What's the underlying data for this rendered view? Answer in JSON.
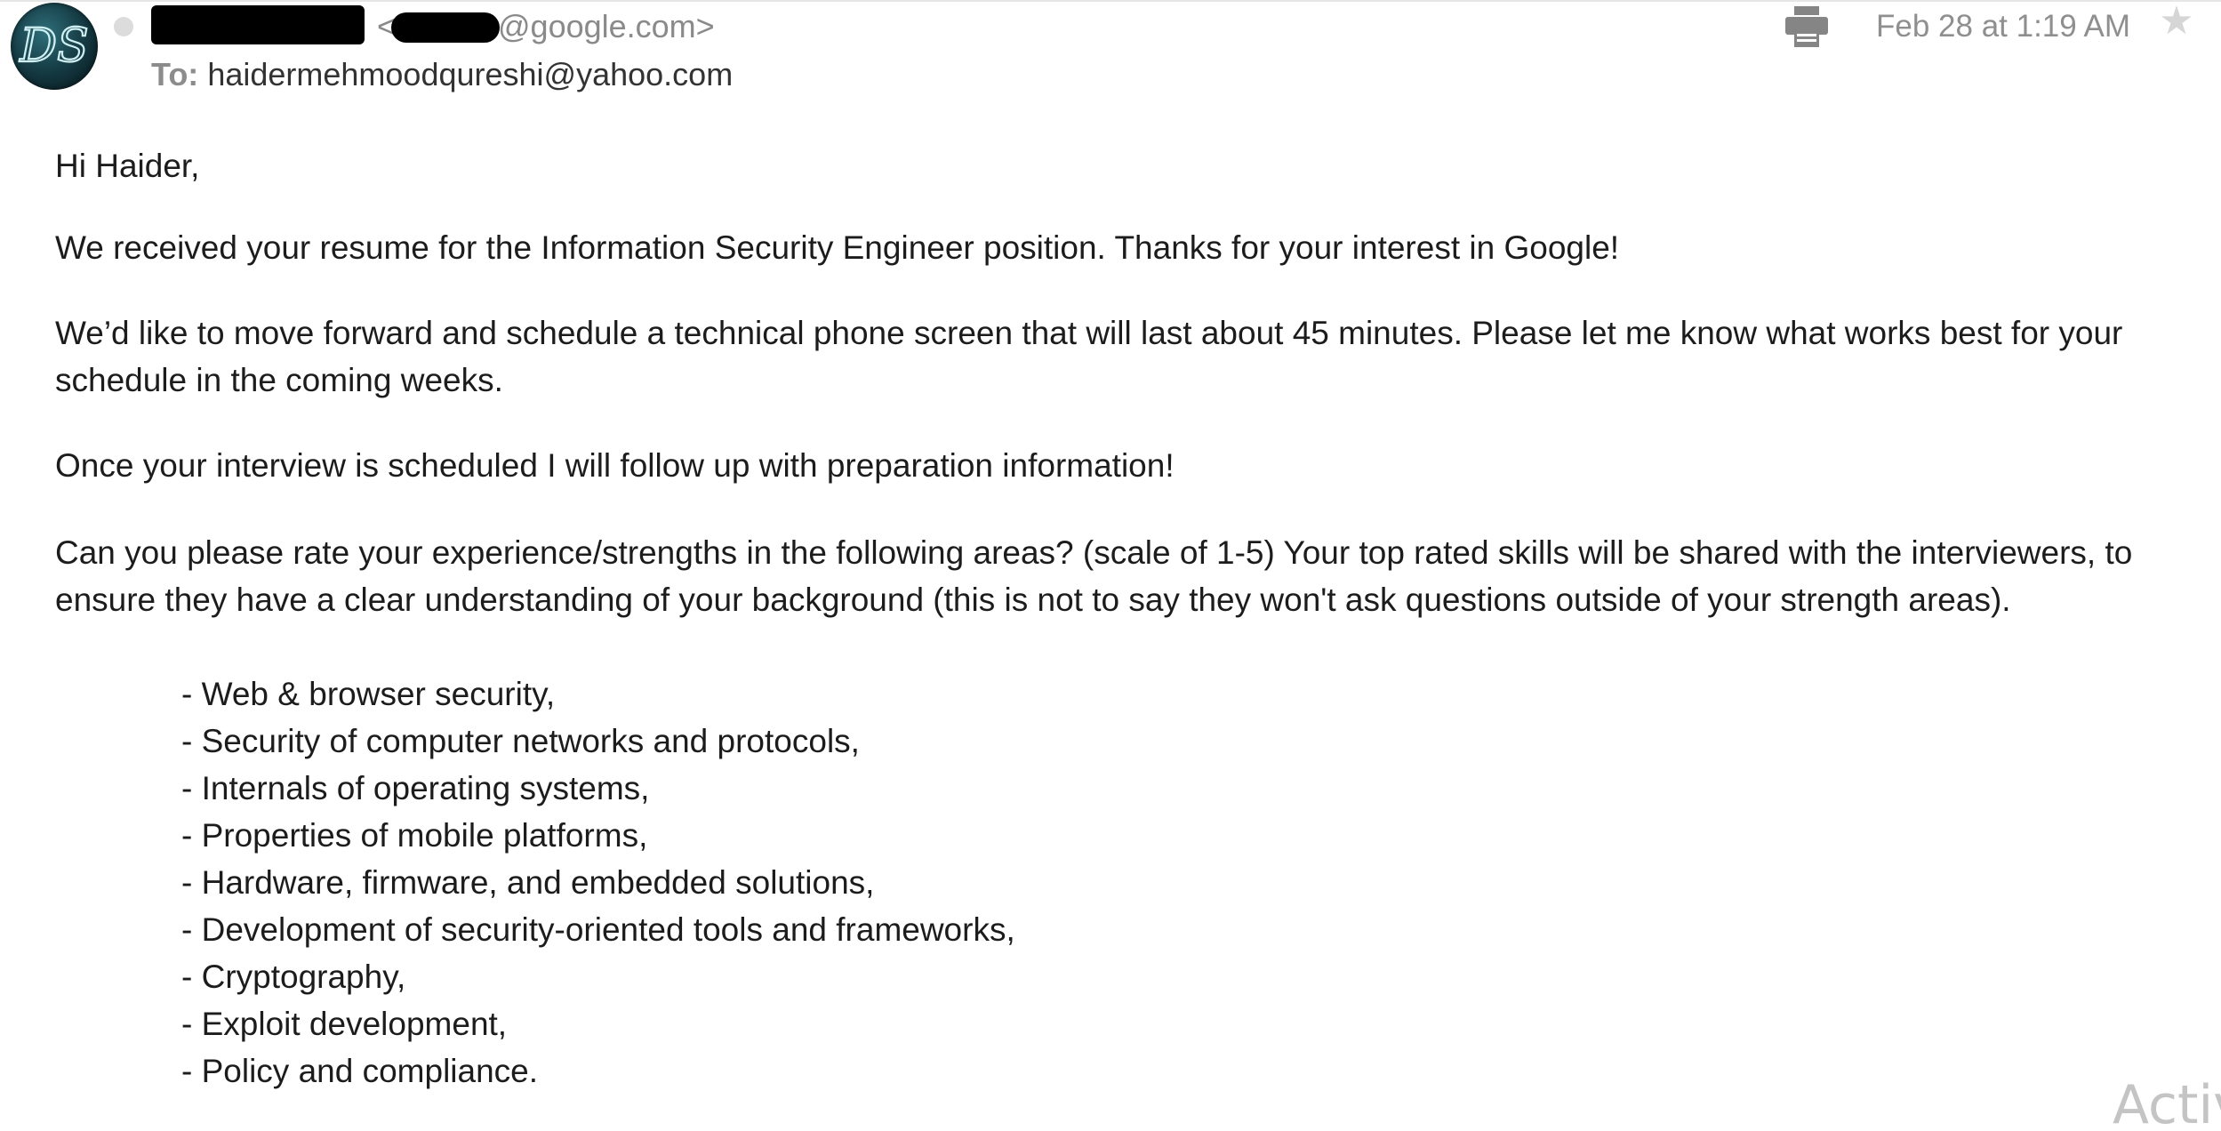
{
  "header": {
    "avatar_initials": "DS",
    "sender_lt": "<",
    "sender_domain": "@google.com>",
    "to_label": "To:",
    "to_address": "haidermehmoodqureshi@yahoo.com",
    "date": "Feb 28 at 1:19 AM",
    "print_icon": "printer-icon",
    "star_icon": "star-icon",
    "star_glyph": "★"
  },
  "message": {
    "greeting": "Hi Haider,",
    "para1": "We received your resume for the Information Security Engineer position. Thanks for your interest in Google!",
    "para2": "We’d like to move forward and schedule a technical phone screen that will last about 45 minutes. Please let me know what works best for your schedule in the coming weeks.",
    "para3": "Once your interview is scheduled I will follow up with preparation information!",
    "para4": "Can you please rate your experience/strengths in the following areas? (scale of 1-5)  Your top rated skills will be shared with the interviewers, to ensure they have a clear understanding of your background (this is not to say they won't ask questions outside of your strength areas).",
    "skills": [
      "- Web & browser security,",
      "- Security of computer networks and protocols,",
      "- Internals of operating systems,",
      "- Properties of mobile platforms,",
      "- Hardware, firmware, and embedded solutions,",
      "- Development of security-oriented tools and frameworks,",
      "- Cryptography,",
      "- Exploit development,",
      "- Policy and compliance."
    ]
  },
  "watermark": "Activ",
  "colors": {
    "meta_gray": "#8a8a8a",
    "body_text": "#1c1c1c",
    "avatar_teal": "#173f48",
    "star_gray": "#d6d6d6"
  }
}
